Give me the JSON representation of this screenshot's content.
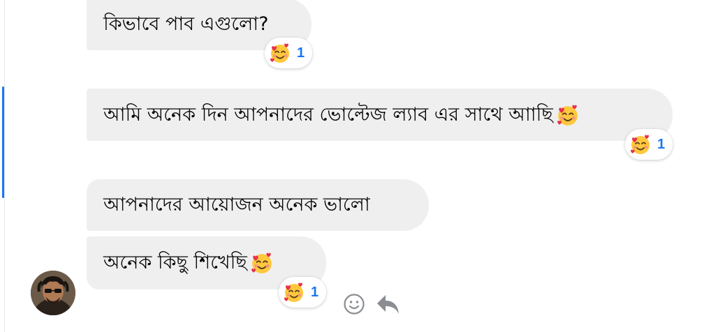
{
  "messages": [
    {
      "text": "কিভাবে পাব এগুলো?",
      "reaction": {
        "emoji": "smiling-face-with-hearts-icon",
        "count": "1"
      }
    },
    {
      "text": "আমি অনেক দিন আপনাদের ভোল্টেজ ল্যাব এর সাথে আাছি",
      "trailing_emoji": "smiling-face-with-hearts-icon",
      "reaction": {
        "emoji": "smiling-face-with-hearts-icon",
        "count": "1"
      }
    },
    {
      "text": "আপনাদের আয়োজন অনেক ভালো"
    },
    {
      "text": "অনেক কিছু শিখেছি ",
      "trailing_emoji": "smiling-face-with-hearts-icon",
      "reaction": {
        "emoji": "smiling-face-with-hearts-icon",
        "count": "1"
      }
    }
  ],
  "actions": {
    "react_icon": "smiley-icon",
    "reply_icon": "reply-icon"
  },
  "colors": {
    "bubble_bg": "#efefef",
    "accent": "#1877f2",
    "text": "#050505",
    "icon_gray": "#8a8d91"
  }
}
